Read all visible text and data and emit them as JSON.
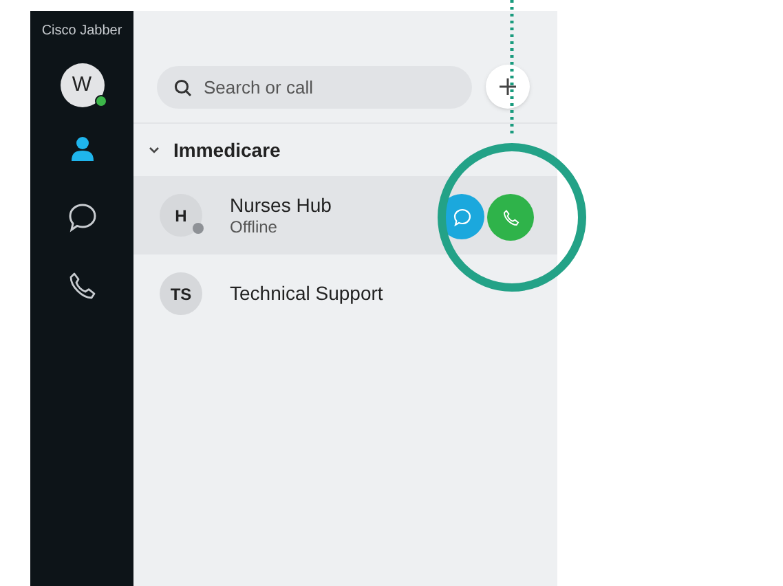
{
  "app_title": "Cisco Jabber",
  "user": {
    "initial": "W",
    "online": true
  },
  "nav": [
    {
      "kind": "contacts",
      "selected": true
    },
    {
      "kind": "chat",
      "selected": false
    },
    {
      "kind": "calls",
      "selected": false
    }
  ],
  "search": {
    "placeholder": "Search or call"
  },
  "group": {
    "name": "Immedicare",
    "expanded": true
  },
  "contacts": [
    {
      "initials": "H",
      "name": "Nurses Hub",
      "status": "Offline",
      "hovered": true,
      "online": false
    },
    {
      "initials": "TS",
      "name": "Technical Support",
      "hovered": false
    }
  ]
}
